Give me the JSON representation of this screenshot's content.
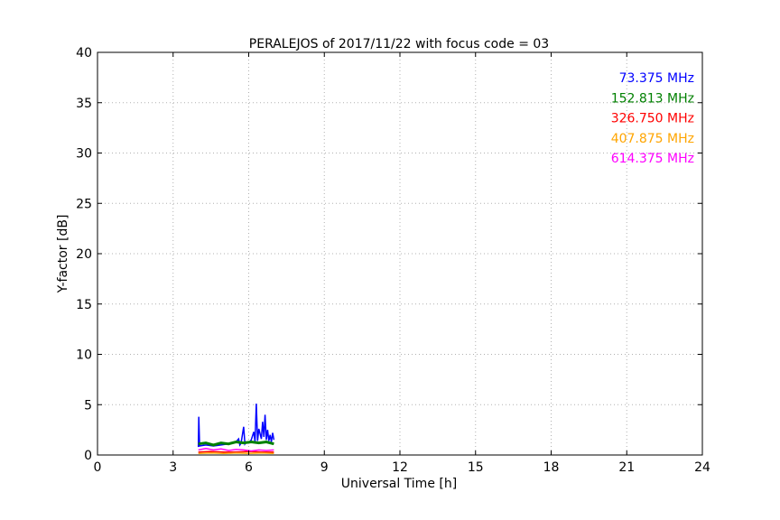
{
  "chart_data": {
    "type": "line",
    "title": "PERALEJOS of 2017/11/22 with focus code = 03",
    "xlabel": "Universal Time [h]",
    "ylabel": "Y-factor [dB]",
    "xlim": [
      0,
      24
    ],
    "ylim": [
      0,
      40
    ],
    "xticks": [
      0,
      3,
      6,
      9,
      12,
      15,
      18,
      21,
      24
    ],
    "yticks": [
      0,
      5,
      10,
      15,
      20,
      25,
      30,
      35,
      40
    ],
    "grid": true,
    "legend_position": "top-right",
    "series": [
      {
        "name": "73.375 MHz",
        "color": "#0000ff",
        "x": [
          4.0,
          4.02,
          4.05,
          4.3,
          4.6,
          4.9,
          5.2,
          5.5,
          5.6,
          5.65,
          5.7,
          5.8,
          5.85,
          5.9,
          6.0,
          6.1,
          6.2,
          6.25,
          6.3,
          6.35,
          6.4,
          6.5,
          6.55,
          6.6,
          6.65,
          6.7,
          6.75,
          6.8,
          6.85,
          6.9,
          6.95,
          7.0
        ],
        "y": [
          0.8,
          3.8,
          0.9,
          1.0,
          0.9,
          1.0,
          1.1,
          1.3,
          1.6,
          1.0,
          1.2,
          2.8,
          1.1,
          1.3,
          1.2,
          1.5,
          2.3,
          1.3,
          5.1,
          1.4,
          2.6,
          1.6,
          3.3,
          1.8,
          4.0,
          1.5,
          2.5,
          1.4,
          2.0,
          1.3,
          2.2,
          1.5
        ]
      },
      {
        "name": "152.813 MHz",
        "color": "#008000",
        "x": [
          4.0,
          4.3,
          4.6,
          4.9,
          5.2,
          5.5,
          5.8,
          6.1,
          6.4,
          6.7,
          7.0
        ],
        "y": [
          1.1,
          1.2,
          1.0,
          1.2,
          1.1,
          1.3,
          1.2,
          1.3,
          1.2,
          1.3,
          1.1
        ]
      },
      {
        "name": "326.750 MHz",
        "color": "#ff0000",
        "x": [
          4.0,
          4.5,
          5.0,
          5.5,
          6.0,
          6.5,
          7.0
        ],
        "y": [
          0.3,
          0.35,
          0.3,
          0.3,
          0.35,
          0.3,
          0.3
        ]
      },
      {
        "name": "407.875 MHz",
        "color": "#ffa500",
        "x": [
          4.0,
          4.5,
          5.0,
          5.5,
          6.0,
          6.5,
          7.0
        ],
        "y": [
          0.15,
          0.2,
          0.15,
          0.2,
          0.15,
          0.2,
          0.15
        ]
      },
      {
        "name": "614.375 MHz",
        "color": "#ff00ff",
        "x": [
          4.0,
          4.3,
          4.6,
          4.9,
          5.2,
          5.5,
          5.8,
          6.1,
          6.4,
          6.7,
          7.0
        ],
        "y": [
          0.5,
          0.65,
          0.5,
          0.6,
          0.45,
          0.55,
          0.5,
          0.4,
          0.5,
          0.45,
          0.5
        ]
      }
    ]
  }
}
